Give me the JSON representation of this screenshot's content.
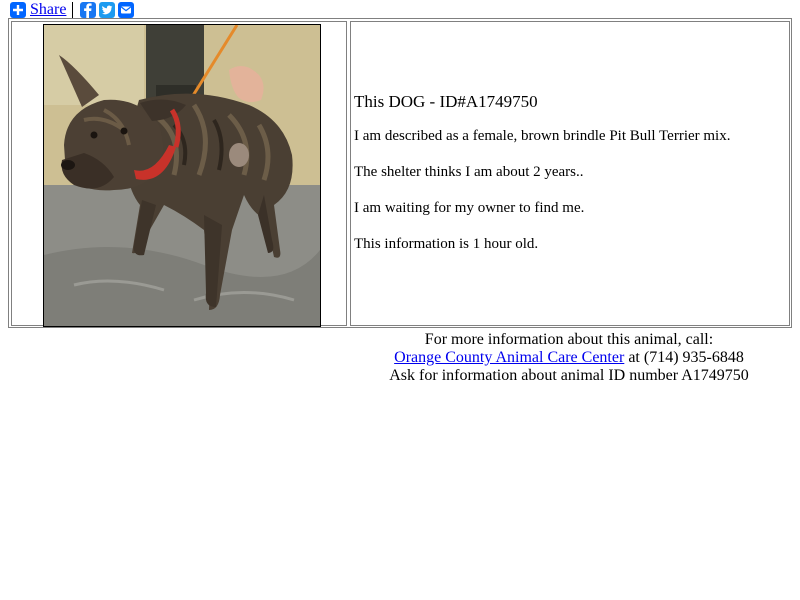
{
  "share": {
    "label": "Share",
    "icons": [
      "plus-icon",
      "facebook-icon",
      "twitter-icon",
      "email-icon"
    ],
    "colors": {
      "addtoany": "#0166ff",
      "facebook": "#1877f2",
      "twitter": "#1d9bf0"
    }
  },
  "animal": {
    "heading": "This DOG - ID#A1749750",
    "description": "I am described as a female, brown brindle Pit Bull Terrier mix.",
    "age": "The shelter thinks I am about 2 years..",
    "status": "I am waiting for my owner to find me.",
    "freshness": "This information is 1 hour old."
  },
  "footer": {
    "line1": "For more information about this animal, call:",
    "center_link": "Orange County Animal Care Center",
    "phone": "at (714) 935-6848",
    "line3": "Ask for information about animal ID number A1749750"
  },
  "colors": {
    "link": "#0000ee",
    "border": "#808080"
  }
}
